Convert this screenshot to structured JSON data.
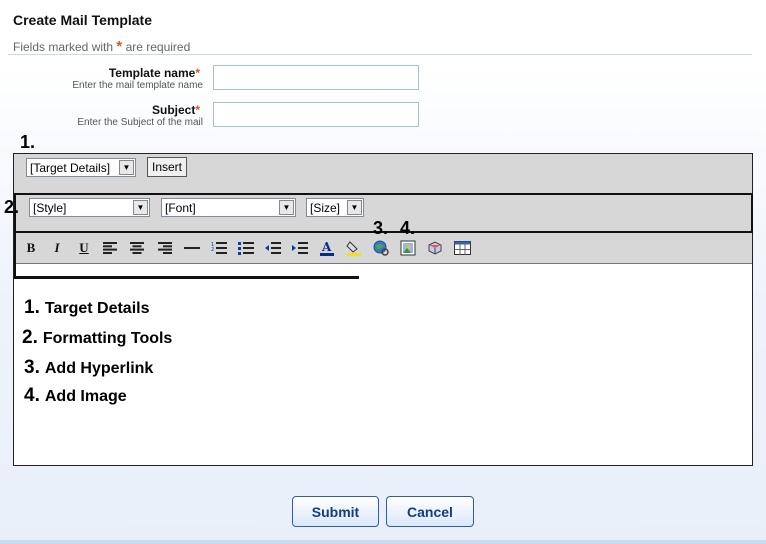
{
  "header": {
    "title": "Create Mail Template",
    "required_note_prefix": "Fields marked with",
    "required_star": "*",
    "required_note_suffix": "are required"
  },
  "form": {
    "template_name": {
      "label": "Template name",
      "hint": "Enter the mail template name",
      "value": ""
    },
    "subject": {
      "label": "Subject",
      "hint": "Enter the Subject of the mail",
      "value": ""
    }
  },
  "toolbar": {
    "target_select": "[Target Details]",
    "insert_label": "Insert",
    "style_select": "[Style]",
    "font_select": "[Font]",
    "size_select": "[Size]",
    "tools": [
      "bold-icon",
      "italic-icon",
      "underline-icon",
      "align-left-icon",
      "align-center-icon",
      "align-right-icon",
      "horizontal-rule-icon",
      "ordered-list-icon",
      "unordered-list-icon",
      "outdent-icon",
      "indent-icon",
      "text-color-icon",
      "highlight-color-icon",
      "hyperlink-icon",
      "image-icon",
      "table-insert-icon",
      "table-icon"
    ]
  },
  "callouts": {
    "c1": "1.",
    "c2": "2.",
    "c3": "3.",
    "c4": "4."
  },
  "legend": [
    {
      "num": "1.",
      "text": "Target Details"
    },
    {
      "num": "2.",
      "text": "Formatting Tools"
    },
    {
      "num": "3.",
      "text": "Add Hyperlink"
    },
    {
      "num": "4.",
      "text": "Add Image"
    }
  ],
  "actions": {
    "submit": "Submit",
    "cancel": "Cancel"
  },
  "colors": {
    "accent": "#123d85",
    "required": "#e8521a",
    "toolbar_bg": "#d7d7d7"
  }
}
